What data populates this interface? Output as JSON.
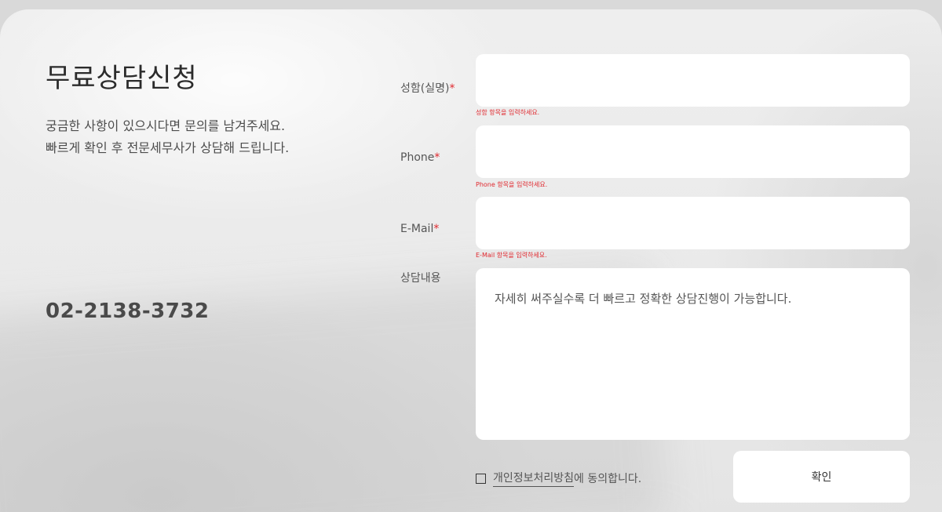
{
  "form": {
    "title": "무료상담신청",
    "intro_line1": "궁금한 사항이 있으시다면 문의를 남겨주세요.",
    "intro_line2": "빠르게 확인 후 전문세무사가 상담해 드립니다.",
    "phone_number": "02-2138-3732",
    "fields": {
      "name": {
        "label": "성함(실명)",
        "required_mark": "*",
        "value": "",
        "error": "성함 항목을 입력하세요."
      },
      "phone": {
        "label": "Phone",
        "required_mark": "*",
        "value": "",
        "error": "Phone 항목을 입력하세요."
      },
      "email": {
        "label": "E-Mail",
        "required_mark": "*",
        "value": "",
        "error": "E-Mail 항목을 입력하세요."
      },
      "message": {
        "label": "상담내용",
        "placeholder": "자세히 써주실수록 더 빠르고 정확한 상담진행이 가능합니다."
      }
    },
    "consent": {
      "checked": false,
      "link_text": "개인정보처리방침",
      "suffix_text": "에 동의합니다."
    },
    "submit_label": "확인",
    "colors": {
      "required": "#e0282e",
      "field_background": "#ffffff",
      "text": "#555555"
    }
  }
}
